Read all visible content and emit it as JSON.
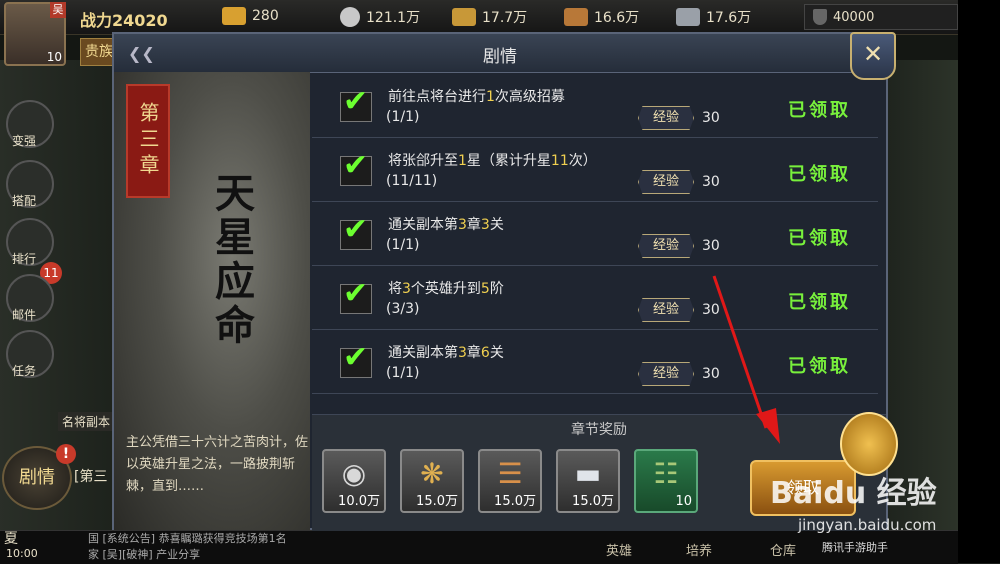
{
  "topbar": {
    "vip_badge": "吴",
    "player_level": "10",
    "power_label": "战力24020",
    "rank_label": "贵族",
    "resources": [
      {
        "icon": "gold-ingot-icon",
        "value": "280",
        "color": "#d8a030"
      },
      {
        "icon": "coin-icon",
        "value": "121.1万",
        "color": "#c8c8c8"
      },
      {
        "icon": "grain-icon",
        "value": "17.7万",
        "color": "#c89838"
      },
      {
        "icon": "wood-icon",
        "value": "16.6万",
        "color": "#b87838"
      },
      {
        "icon": "iron-icon",
        "value": "17.6万",
        "color": "#9aa0a8"
      }
    ],
    "shield_value": "40000"
  },
  "sidebar": {
    "items": [
      {
        "label": "变强"
      },
      {
        "label": "搭配"
      },
      {
        "label": "排行"
      },
      {
        "label": "邮件"
      },
      {
        "label": "任务"
      }
    ],
    "mail_badge": "11",
    "mingjiang_label": "名将副本",
    "juqing_label": "剧情",
    "alert": "!",
    "chapter_mini": "[第三"
  },
  "panel": {
    "title": "剧情",
    "chapter_tag": "第三章",
    "chapter_name": "天星应命",
    "description": "主公凭借三十六计之苦肉计，佐以英雄升星之法，一路披荆斩棘，直到……"
  },
  "tasks": [
    {
      "pre": "前往点将台进行",
      "hl1": "1",
      "mid": "次高级招募",
      "hl2": "",
      "post": "",
      "progress": "(1/1)",
      "exp_label": "经验",
      "exp": "30",
      "status": "已领取"
    },
    {
      "pre": "将张郃升至",
      "hl1": "1",
      "mid": "星（累计升星",
      "hl2": "11",
      "post": "次）",
      "progress": "(11/11)",
      "exp_label": "经验",
      "exp": "30",
      "status": "已领取"
    },
    {
      "pre": "通关副本第",
      "hl1": "3",
      "mid": "章",
      "hl2": "3",
      "post": "关",
      "progress": "(1/1)",
      "exp_label": "经验",
      "exp": "30",
      "status": "已领取"
    },
    {
      "pre": "将",
      "hl1": "3",
      "mid": "个英雄升到",
      "hl2": "5",
      "post": "阶",
      "progress": "(3/3)",
      "exp_label": "经验",
      "exp": "30",
      "status": "已领取"
    },
    {
      "pre": "通关副本第",
      "hl1": "3",
      "mid": "章",
      "hl2": "6",
      "post": "关",
      "progress": "(1/1)",
      "exp_label": "经验",
      "exp": "30",
      "status": "已领取"
    }
  ],
  "rewards": {
    "title": "章节奖励",
    "items": [
      {
        "icon": "coin-icon",
        "count": "10.0万"
      },
      {
        "icon": "grain-icon",
        "count": "15.0万"
      },
      {
        "icon": "wood-icon",
        "count": "15.0万"
      },
      {
        "icon": "iron-icon",
        "count": "15.0万"
      },
      {
        "icon": "bamboo-scroll-icon",
        "count": "10"
      }
    ],
    "claim_label": "领取"
  },
  "bottom": {
    "season": "夏",
    "time": "10:00",
    "chat_line1": "国  [系统公告] 恭喜瞩璐获得竞技场第1名",
    "chat_line2": "家  [吴][破神] 产业分享",
    "tabs": [
      "英雄",
      "培养",
      "仓库"
    ],
    "assistant": "腾讯手游助手"
  },
  "watermark": {
    "brand": "Baidu 经验",
    "url": "jingyan.baidu.com"
  }
}
